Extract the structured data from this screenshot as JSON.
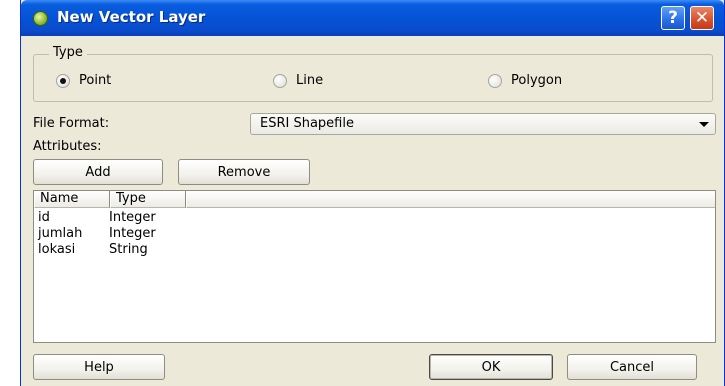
{
  "window": {
    "title": "New Vector Layer"
  },
  "type_group": {
    "title": "Type",
    "options": [
      {
        "label": "Point",
        "checked": true
      },
      {
        "label": "Line",
        "checked": false
      },
      {
        "label": "Polygon",
        "checked": false
      }
    ]
  },
  "file_format": {
    "label": "File Format:",
    "value": "ESRI Shapefile"
  },
  "attributes": {
    "label": "Attributes:",
    "add_label": "Add",
    "remove_label": "Remove"
  },
  "table": {
    "columns": [
      "Name",
      "Type"
    ],
    "rows": [
      {
        "name": "id",
        "type": "Integer"
      },
      {
        "name": "jumlah",
        "type": "Integer"
      },
      {
        "name": "lokasi",
        "type": "String"
      }
    ]
  },
  "buttons": {
    "help": "Help",
    "ok": "OK",
    "cancel": "Cancel"
  },
  "icons": {
    "titlebar_help": "?",
    "titlebar_close": "✕"
  }
}
